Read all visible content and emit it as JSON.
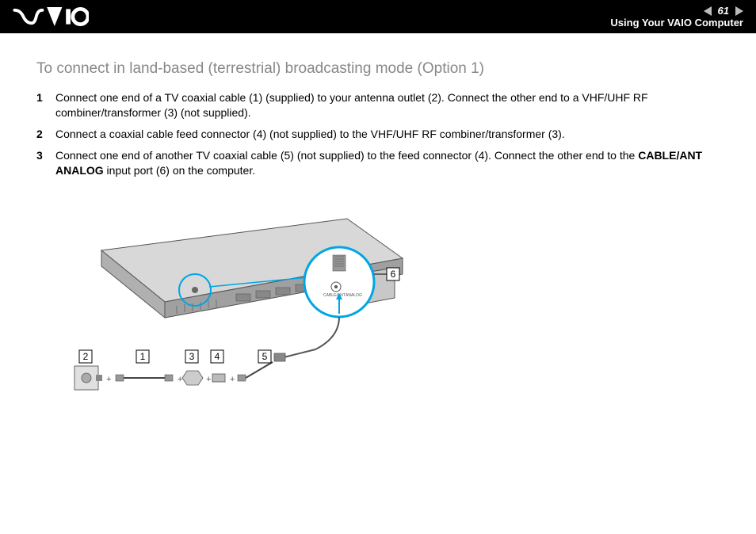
{
  "header": {
    "page_number": "61",
    "section_title": "Using Your VAIO Computer"
  },
  "content": {
    "heading": "To connect in land-based (terrestrial) broadcasting mode (Option 1)",
    "steps": [
      {
        "text_before": "Connect one end of a TV coaxial cable (1) (supplied) to your antenna outlet (2). Connect the other end to a VHF/UHF RF combiner/transformer (3) (not supplied)."
      },
      {
        "text_before": "Connect a coaxial cable feed connector (4) (not supplied) to the VHF/UHF RF combiner/transformer (3)."
      },
      {
        "text_before": "Connect one end of another TV coaxial cable (5) (not supplied) to the feed connector (4). Connect the other end to the ",
        "bold": "CABLE/ANT ANALOG",
        "text_after": " input port (6) on the computer."
      }
    ]
  },
  "diagram": {
    "callouts": [
      "1",
      "2",
      "3",
      "4",
      "5",
      "6"
    ],
    "labels": {
      "cable_ant": "CABLE/ANT",
      "analog": "ANALOG"
    }
  }
}
